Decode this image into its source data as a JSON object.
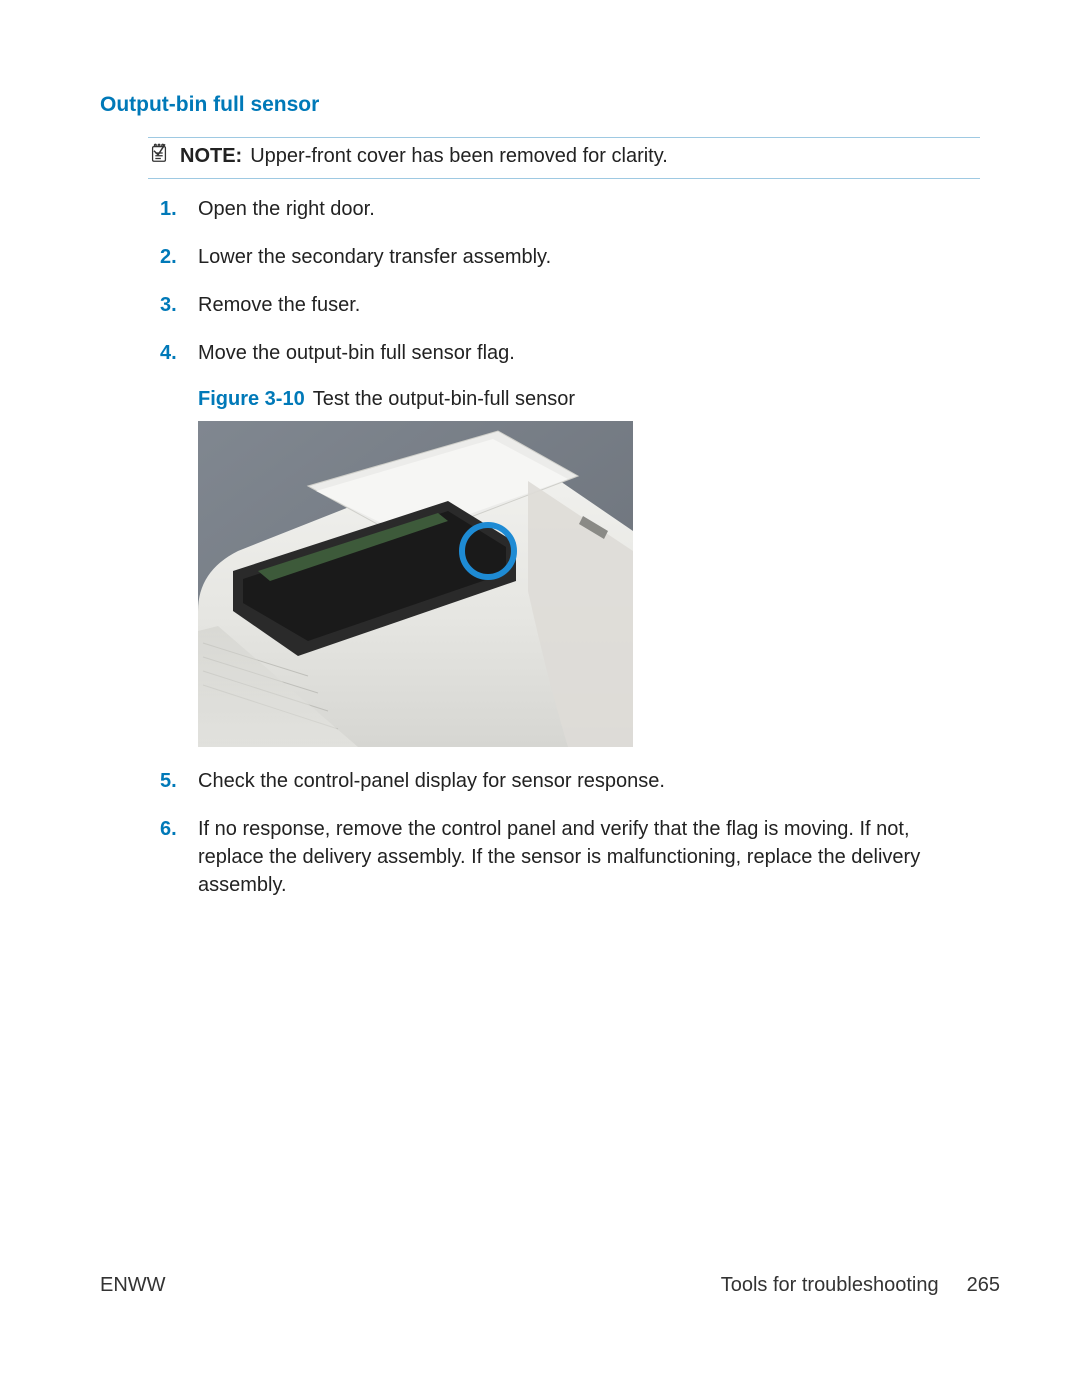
{
  "heading": "Output-bin full sensor",
  "note": {
    "label": "NOTE:",
    "text": "Upper-front cover has been removed for clarity."
  },
  "steps": {
    "s1": {
      "num": "1.",
      "text": "Open the right door."
    },
    "s2": {
      "num": "2.",
      "text": "Lower the secondary transfer assembly."
    },
    "s3": {
      "num": "3.",
      "text": "Remove the fuser."
    },
    "s4": {
      "num": "4.",
      "text": "Move the output-bin full sensor flag."
    },
    "s5": {
      "num": "5.",
      "text": "Check the control-panel display for sensor response."
    },
    "s6": {
      "num": "6.",
      "text": "If no response, remove the control panel and verify that the flag is moving. If not, replace the delivery assembly. If the sensor is malfunctioning, replace the delivery assembly."
    }
  },
  "figure": {
    "label": "Figure 3-10",
    "caption": "Test the output-bin-full sensor"
  },
  "footer": {
    "left": "ENWW",
    "section": "Tools for troubleshooting",
    "page": "265"
  }
}
